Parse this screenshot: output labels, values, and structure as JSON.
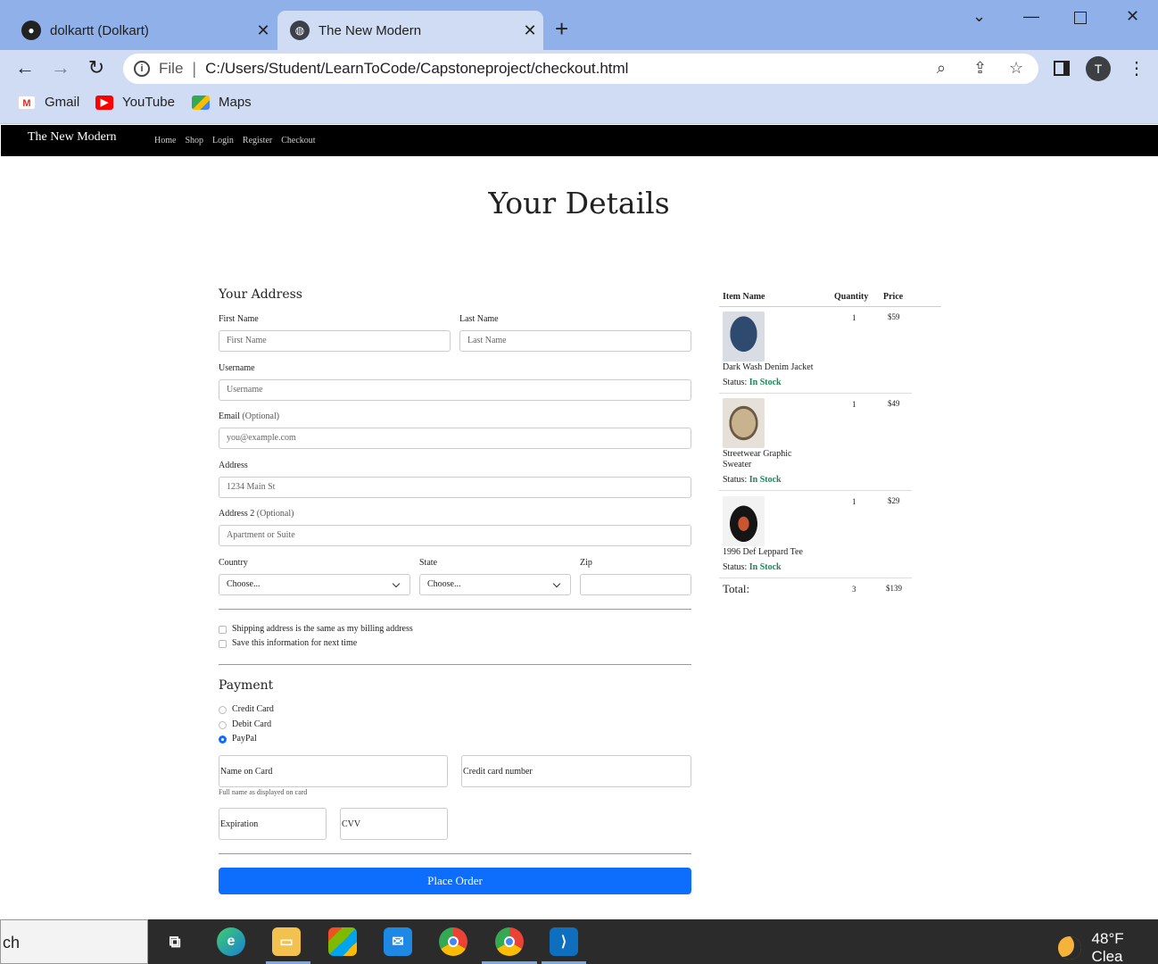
{
  "browser": {
    "tabs": [
      {
        "label": "dolkartt (Dolkart)",
        "icon": "github-icon",
        "active": false
      },
      {
        "label": "The New Modern",
        "icon": "globe-icon",
        "active": true
      }
    ],
    "file_label": "File",
    "url": "C:/Users/Student/LearnToCode/Capstoneproject/checkout.html",
    "profile_initial": "T",
    "bookmarks": [
      {
        "label": "Gmail",
        "icon": "gmail-icon"
      },
      {
        "label": "YouTube",
        "icon": "youtube-icon"
      },
      {
        "label": "Maps",
        "icon": "maps-icon"
      }
    ]
  },
  "site": {
    "brand": "The New Modern",
    "nav": [
      "Home",
      "Shop",
      "Login",
      "Register",
      "Checkout"
    ]
  },
  "page": {
    "title": "Your Details",
    "address_heading": "Your Address",
    "fields": {
      "first_name": {
        "label": "First Name",
        "placeholder": "First Name"
      },
      "last_name": {
        "label": "Last Name",
        "placeholder": "Last Name"
      },
      "username": {
        "label": "Username",
        "placeholder": "Username"
      },
      "email": {
        "label": "Email",
        "optional": "(Optional)",
        "placeholder": "you@example.com"
      },
      "address": {
        "label": "Address",
        "placeholder": "1234 Main St"
      },
      "address2": {
        "label": "Address 2",
        "optional": "(Optional)",
        "placeholder": "Apartment or Suite"
      },
      "country": {
        "label": "Country",
        "value": "Choose..."
      },
      "state": {
        "label": "State",
        "value": "Choose..."
      },
      "zip": {
        "label": "Zip",
        "value": ""
      }
    },
    "checkboxes": [
      {
        "label": "Shipping address is the same as my billing address",
        "checked": false
      },
      {
        "label": "Save this information for next time",
        "checked": false
      }
    ],
    "payment_heading": "Payment",
    "payment_methods": [
      {
        "label": "Credit Card",
        "selected": false
      },
      {
        "label": "Debit Card",
        "selected": false
      },
      {
        "label": "PayPal",
        "selected": true
      }
    ],
    "card": {
      "name_label": "Name on Card",
      "name_help": "Full name as displayed on card",
      "number_label": "Credit card number",
      "expiration_label": "Expiration",
      "cvv_label": "CVV"
    },
    "place_order": "Place Order"
  },
  "cart": {
    "headers": {
      "item": "Item Name",
      "quantity": "Quantity",
      "price": "Price"
    },
    "status_label": "Status:",
    "items": [
      {
        "name": "Dark Wash Denim Jacket",
        "status": "In Stock",
        "quantity": "1",
        "price": "$59"
      },
      {
        "name": "Streetwear Graphic Sweater",
        "status": "In Stock",
        "quantity": "1",
        "price": "$49"
      },
      {
        "name": "1996 Def Leppard Tee",
        "status": "In Stock",
        "quantity": "1",
        "price": "$29"
      }
    ],
    "total_label": "Total:",
    "total_quantity": "3",
    "total_price": "$139"
  },
  "taskbar": {
    "search_text": "ch",
    "weather": "48°F  Clea",
    "apps": [
      "task-view-icon",
      "edge-icon",
      "file-explorer-icon",
      "store-icon",
      "mail-icon",
      "chrome-icon",
      "chrome-profile-icon",
      "vscode-icon"
    ]
  },
  "colors": {
    "accent": "#0d6efd",
    "in_stock": "#198754",
    "tabbar": "#8fb0e8",
    "toolbar": "#cfdcf3"
  }
}
